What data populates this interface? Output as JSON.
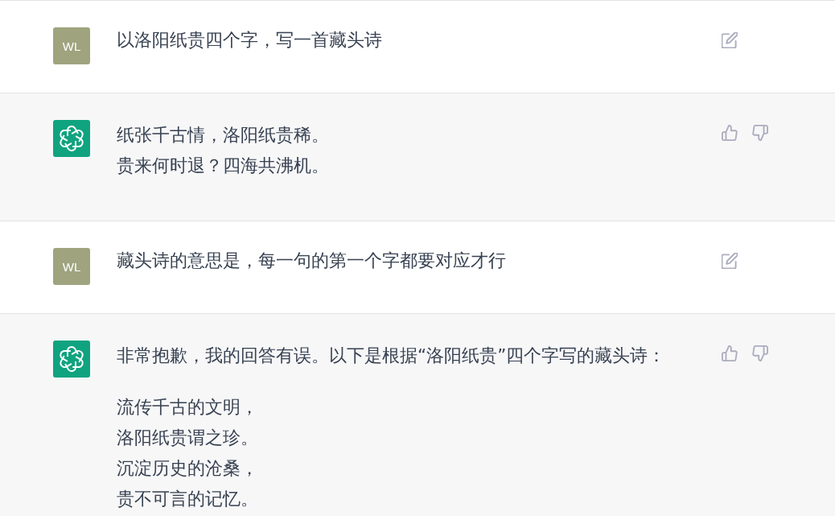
{
  "messages": [
    {
      "kind": "user",
      "avatar": "WL",
      "paragraphs": [
        {
          "lines": [
            "以洛阳纸贵四个字，写一首藏头诗"
          ]
        }
      ]
    },
    {
      "kind": "assistant",
      "paragraphs": [
        {
          "lines": [
            "纸张千古情，洛阳纸贵稀。",
            "贵来何时退？四海共沸机。"
          ]
        }
      ]
    },
    {
      "kind": "user",
      "avatar": "WL",
      "paragraphs": [
        {
          "lines": [
            "藏头诗的意思是，每一句的第一个字都要对应才行"
          ]
        }
      ]
    },
    {
      "kind": "assistant",
      "paragraphs": [
        {
          "lines": [
            "非常抱歉，我的回答有误。以下是根据“洛阳纸贵”四个字写的藏头诗："
          ]
        },
        {
          "lines": [
            "流传千古的文明，",
            "洛阳纸贵谓之珍。",
            "沉淀历史的沧桑，",
            "贵不可言的记忆。"
          ]
        }
      ]
    }
  ]
}
